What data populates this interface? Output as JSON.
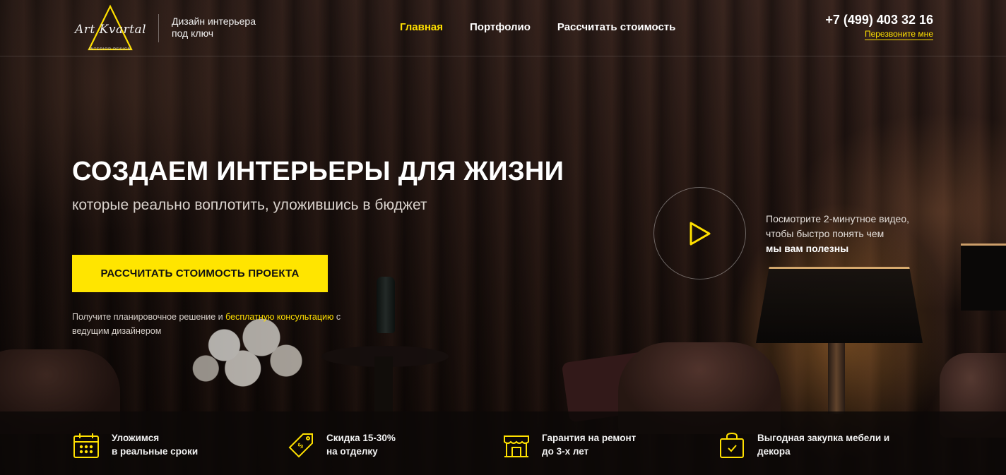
{
  "colors": {
    "accent": "#ffe500",
    "text": "#ffffff"
  },
  "header": {
    "logo": {
      "text": "Art Kvartal",
      "sub": "INTERIOR DESIGN"
    },
    "tagline": "Дизайн интерьера под ключ",
    "nav": [
      {
        "label": "Главная",
        "active": true
      },
      {
        "label": "Портфолио",
        "active": false
      },
      {
        "label": "Рассчитать стоимость",
        "active": false
      }
    ],
    "phone": "+7 (499) 403 32 16",
    "callback": "Перезвоните мне"
  },
  "hero": {
    "title": "СОЗДАЕМ ИНТЕРЬЕРЫ ДЛЯ ЖИЗНИ",
    "subtitle": "которые реально воплотить, уложившись в бюджет",
    "cta": "РАССЧИТАТЬ СТОИМОСТЬ ПРОЕКТА",
    "note_before": "Получите планировочное решение и ",
    "note_link": "бесплатную консультацию",
    "note_after": " с ведущим дизайнером"
  },
  "video": {
    "icon": "play-icon",
    "text": "Посмотрите 2-минутное видео, чтобы быстро понять чем",
    "text_bold": "мы вам полезны"
  },
  "features": [
    {
      "icon": "calendar-icon",
      "line1": "Уложимся",
      "line2": "в реальные сроки"
    },
    {
      "icon": "price-tag-icon",
      "line1": "Скидка 15-30%",
      "line2": "на отделку"
    },
    {
      "icon": "storefront-icon",
      "line1": "Гарантия на ремонт",
      "line2": "до 3-х лет"
    },
    {
      "icon": "shopping-bag-icon",
      "line1": "Выгодная закупка мебели и",
      "line2": "декора"
    }
  ]
}
